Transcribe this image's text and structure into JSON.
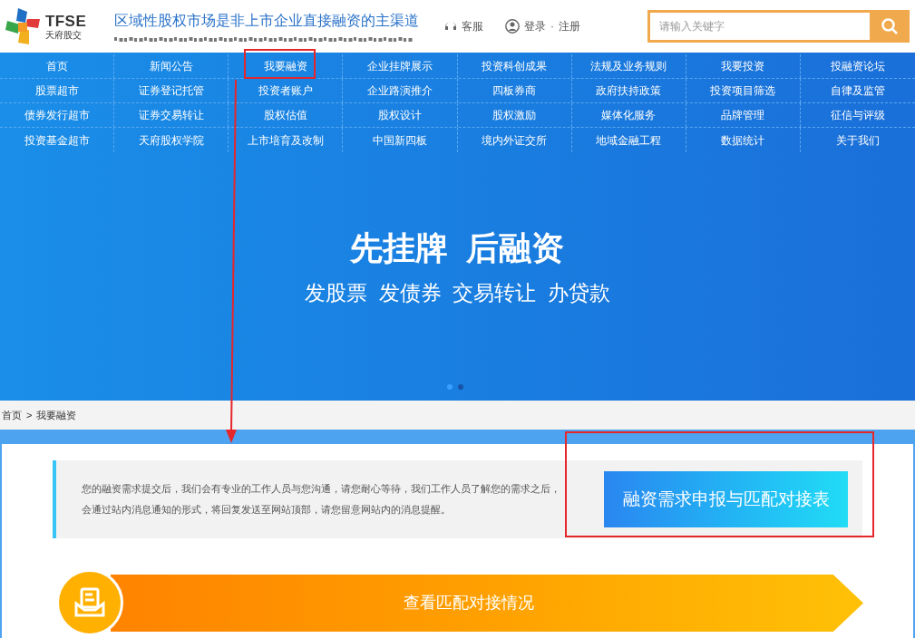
{
  "header": {
    "logo_text": "TFSE",
    "logo_subtext": "天府股交",
    "slogan": "区域性股权市场是非上市企业直接融资的主渠道",
    "service": "客服",
    "login": "登录",
    "separator": "·",
    "register": "注册",
    "search": {
      "placeholder": "请输入关键字"
    }
  },
  "nav": [
    [
      "首页",
      "新闻公告",
      "我要融资",
      "企业挂牌展示",
      "投资科创成果",
      "法规及业务规则",
      "我要投资",
      "投融资论坛"
    ],
    [
      "股票超市",
      "证券登记托管",
      "投资者账户",
      "企业路演推介",
      "四板券商",
      "政府扶持政策",
      "投资项目筛选",
      "自律及监管"
    ],
    [
      "债券发行超市",
      "证券交易转让",
      "股权估值",
      "股权设计",
      "股权激励",
      "媒体化服务",
      "品牌管理",
      "征信与评级"
    ],
    [
      "投资基金超市",
      "天府股权学院",
      "上市培育及改制",
      "中国新四板",
      "境内外证交所",
      "地域金融工程",
      "数据统计",
      "关于我们"
    ]
  ],
  "banner": {
    "title": "先挂牌  后融资",
    "subtitle": "发股票  发债券  交易转让  办贷款",
    "dots": [
      {
        "selected": true
      },
      {
        "selected": false
      }
    ]
  },
  "breadcrumb": {
    "home": "首页",
    "separator": ">",
    "current": "我要融资"
  },
  "notice": {
    "text": "您的融资需求提交后，我们会有专业的工作人员与您沟通，请您耐心等待，我们工作人员了解您的需求之后，会通过站内消息通知的形式，将回复发送至网站顶部，请您留意网站内的消息提醒。",
    "button": "融资需求申报与匹配对接表"
  },
  "match_banner": {
    "label": "查看匹配对接情况"
  }
}
